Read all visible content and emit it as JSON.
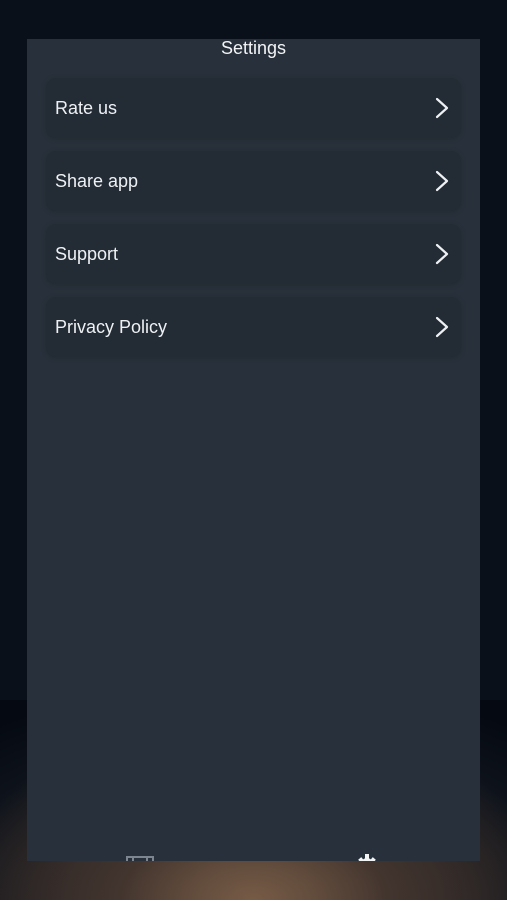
{
  "header": {
    "title": "Settings"
  },
  "settings": {
    "items": [
      {
        "label": "Rate us",
        "icon": "chevron-right-icon"
      },
      {
        "label": "Share app",
        "icon": "chevron-right-icon"
      },
      {
        "label": "Support",
        "icon": "chevron-right-icon"
      },
      {
        "label": "Privacy Policy",
        "icon": "chevron-right-icon"
      }
    ]
  },
  "tab_bar": {
    "tabs": [
      {
        "icon": "film-icon"
      },
      {
        "icon": "gear-icon"
      }
    ]
  },
  "colors": {
    "card_background": "#28313b",
    "row_background": "#232b34",
    "text": "#eef1f4",
    "page_background": "#0a1019"
  }
}
